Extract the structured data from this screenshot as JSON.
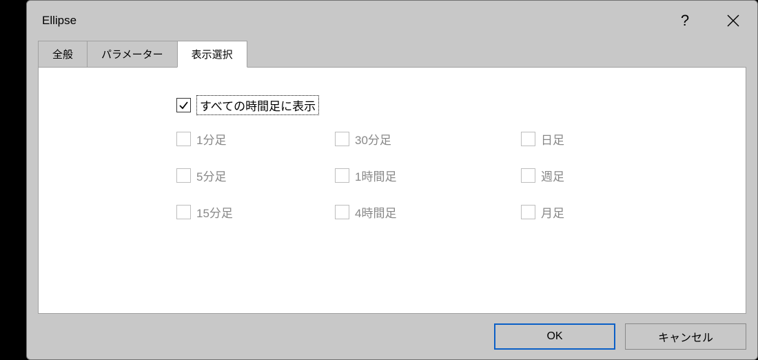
{
  "dialog": {
    "title": "Ellipse"
  },
  "tabs": {
    "general": "全般",
    "parameters": "パラメーター",
    "display": "表示選択"
  },
  "master": {
    "label": "すべての時間足に表示"
  },
  "timeframes": {
    "m1": "1分足",
    "m5": "5分足",
    "m15": "15分足",
    "m30": "30分足",
    "h1": "1時間足",
    "h4": "4時間足",
    "d1": "日足",
    "w1": "週足",
    "mn": "月足"
  },
  "buttons": {
    "ok": "OK",
    "cancel": "キャンセル"
  }
}
